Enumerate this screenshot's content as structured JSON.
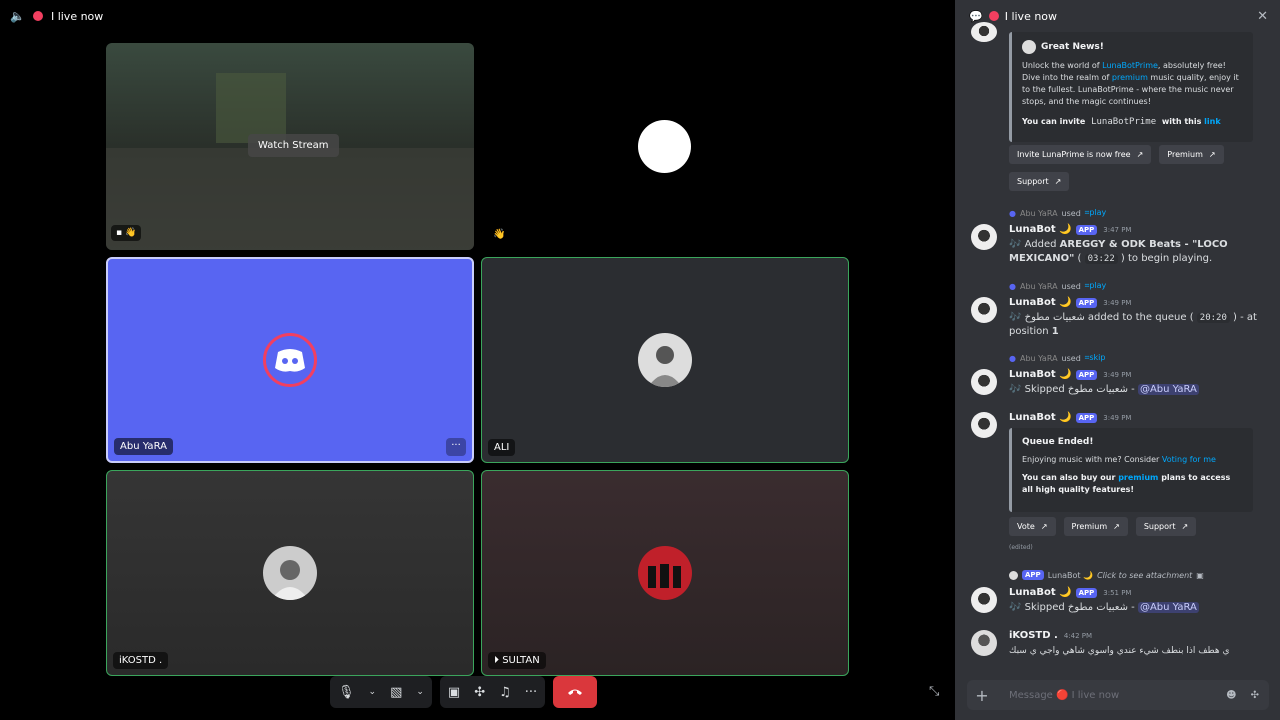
{
  "top_left": {
    "status": "I live now"
  },
  "tiles": {
    "stream": {
      "overlay": "Watch Stream"
    },
    "user1": {
      "name": "Abu YaRA"
    },
    "user2": {
      "name": "ALI"
    },
    "user3": {
      "name": "iKOSTD ."
    },
    "user4": {
      "name": "SULTAN"
    }
  },
  "chat": {
    "header": "I live now",
    "embed_top": {
      "title": "Great News!",
      "line1": "Unlock the world of ",
      "link1": "LunaBotPrime",
      "line2": ", absolutely free! Dive into the realm of ",
      "link2": "premium",
      "line3": " music quality, enjoy it to the fullest. LunaBotPrime - where the music never stops, and the magic continues!",
      "invite_prefix": "You can invite ",
      "invite_code": "LunaBotPrime",
      "invite_suffix": " with this ",
      "invite_link": "link",
      "btn1": "Invite LunaPrime is now free",
      "btn2": "Premium",
      "btn3": "Support"
    },
    "messages": [
      {
        "reply_user": "Abu YaRA",
        "reply_cmd": "play",
        "author": "LunaBot 🌙",
        "app": "APP",
        "time": "3:47 PM",
        "text_pre": "🎶 Added ",
        "bold": "AREGGY & ODK Beats - \"LOCO MEXICANO\"",
        "text_mid": " ( ",
        "code": "03:22",
        "text_post": " ) to begin playing."
      },
      {
        "reply_user": "Abu YaRA",
        "reply_cmd": "play",
        "author": "LunaBot 🌙",
        "app": "APP",
        "time": "3:49 PM",
        "text_pre": "🎶 شعبيات مطوخ added to the queue ( ",
        "code": "20:20",
        "text_post": " ) - at position ",
        "bold": "1"
      },
      {
        "reply_user": "Abu YaRA",
        "reply_cmd": "skip",
        "author": "LunaBot 🌙",
        "app": "APP",
        "time": "3:49 PM",
        "text_pre": "🎶 Skipped شعبيات مطوخ - ",
        "mention": "@Abu YaRA"
      },
      {
        "author": "LunaBot 🌙",
        "app": "APP",
        "time": "3:49 PM"
      }
    ],
    "queue_embed": {
      "title": "Queue Ended!",
      "line1": "Enjoying music with me? Consider ",
      "link1": "Voting for me",
      "line2_prefix": "You can also buy our ",
      "link2": "premium",
      "line2_suffix": " plans to access all high quality features!",
      "btn1": "Vote",
      "btn2": "Premium",
      "btn3": "Support",
      "edited": "(edited)"
    },
    "msg5": {
      "reply_text": "LunaBot 🌙",
      "reply_app": "APP",
      "reply_italic": "Click to see attachment",
      "author": "LunaBot 🌙",
      "app": "APP",
      "time": "3:51 PM",
      "text_pre": "🎶 Skipped شعبيات مطوخ - ",
      "mention": "@Abu YaRA"
    },
    "msg6": {
      "author": "iKOSTD .",
      "time": "4:42 PM",
      "text": "ي هطف اذا بنطف شيء عندي واسوي شاهي واجي ي سبك"
    },
    "composer": {
      "placeholder": "Message 🔴 I live now"
    }
  },
  "colors": {
    "blurple": "#5865f2",
    "red": "#da373c",
    "panel": "#313338"
  }
}
